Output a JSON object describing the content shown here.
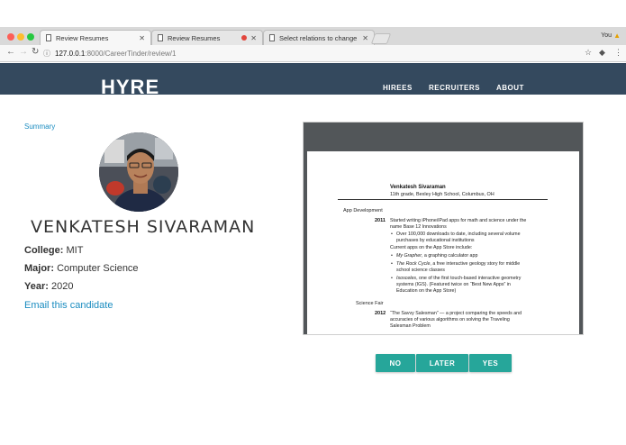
{
  "browser": {
    "tabs": [
      {
        "label": "Review Resumes",
        "active": true
      },
      {
        "label": "Review Resumes",
        "active": false
      },
      {
        "label": "Select relations to change | Dj",
        "active": false
      }
    ],
    "profile": "You",
    "url_host": "127.0.0.1",
    "url_path": ":8000/CareerTinder/review/1"
  },
  "site": {
    "logo": "HYRE",
    "nav": [
      "HIREES",
      "RECRUITERS",
      "ABOUT"
    ],
    "header_color": "#34495e"
  },
  "profile": {
    "summary_link": "Summary",
    "name": "VENKATESH SIVARAMAN",
    "college_label": "College:",
    "college": "MIT",
    "major_label": "Major:",
    "major": "Computer Science",
    "year_label": "Year:",
    "year": "2020",
    "email_link": "Email this candidate",
    "link_color": "#1a8cc0"
  },
  "resume": {
    "name": "Venkatesh Sivaraman",
    "school": "11th grade, Bexley High School, Columbus, OH",
    "sections": {
      "app_dev": "App Development",
      "science_fair": "Science Fair"
    },
    "year_2011": "2011",
    "line_2011_a": "Started writing iPhone/iPad apps for math and science under the",
    "line_2011_b": "name Base 12 Innovations",
    "bullet_downloads_a": "Over 100,000 downloads to date, including several volume",
    "bullet_downloads_b": "purchases by educational institutions",
    "current_apps": "Current apps on the App Store include:",
    "app1_title": "My Grapher",
    "app1_desc": ", a graphing calculator app",
    "app2_title": "The Rock Cycle",
    "app2_desc_a": ", a free interactive geology story for middle",
    "app2_desc_b": "school science classes",
    "app3_title": "Isosceles",
    "app3_desc_a": ", one of the first touch-based interactive geometry",
    "app3_desc_b": "systems (IGS). (Featured twice on “Best New Apps” in",
    "app3_desc_c": "Education on the App Store)",
    "year_2012": "2012",
    "line_2012_a": "“The Savvy Salesman” — a project comparing the speeds and",
    "line_2012_b": "accuracies of various algorithms on solving the Traveling",
    "line_2012_c": "Salesman Problem"
  },
  "actions": {
    "no": "NO",
    "later": "LATER",
    "yes": "YES",
    "button_color": "#26a69a"
  }
}
